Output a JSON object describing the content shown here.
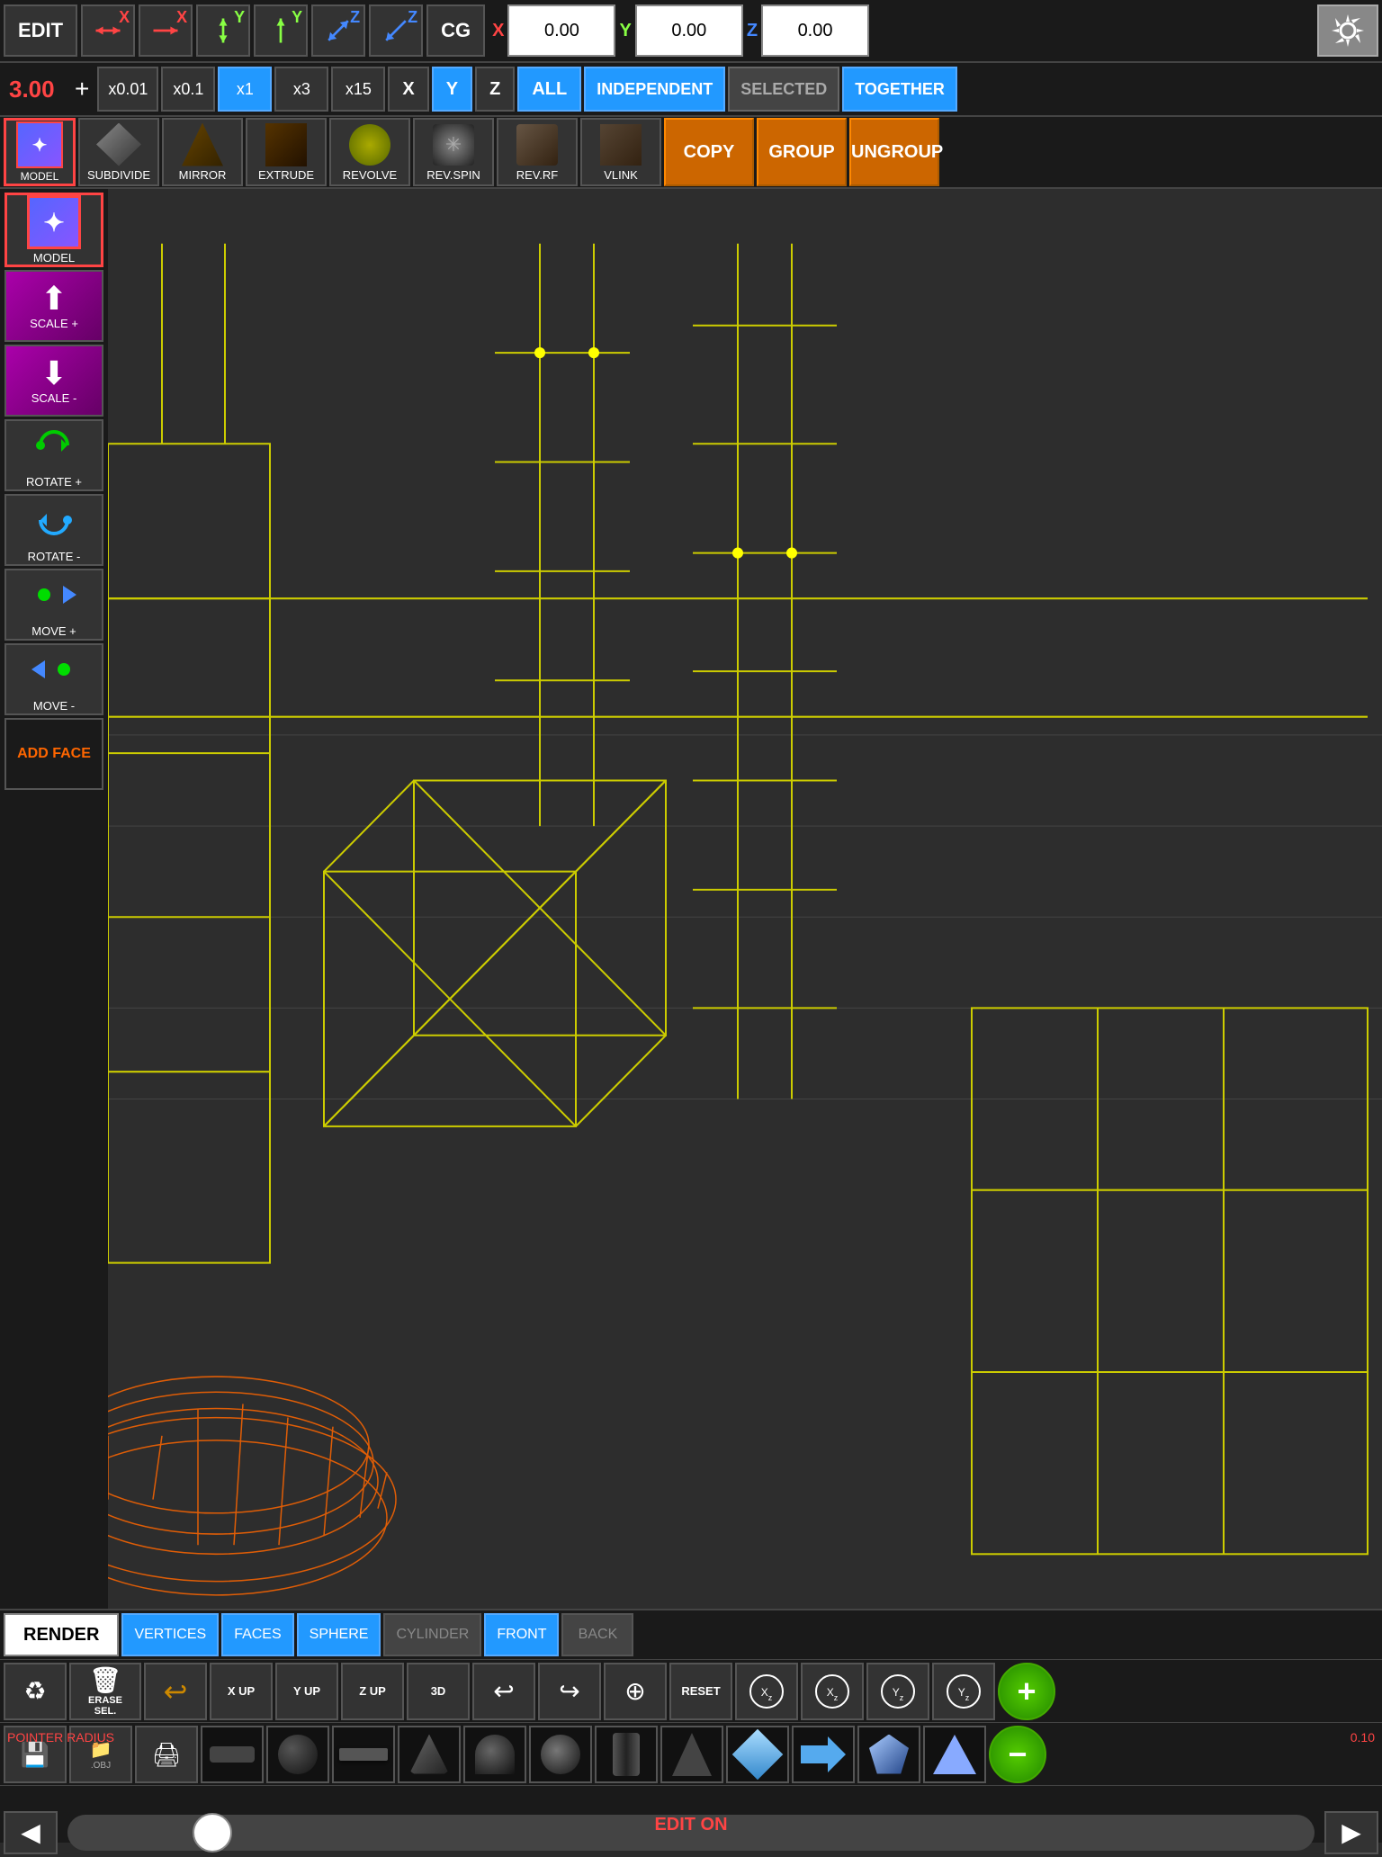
{
  "toolbar": {
    "edit_label": "EDIT",
    "cg_label": "CG",
    "settings_label": "⚙",
    "x_coord": "0.00",
    "y_coord": "0.00",
    "z_coord": "0.00"
  },
  "second_toolbar": {
    "value": "3.00",
    "plus_label": "+",
    "mult_options": [
      "x0.01",
      "x0.1",
      "x1",
      "x3",
      "x15"
    ],
    "active_mult": "x1",
    "axes": [
      "X",
      "Y",
      "Z",
      "ALL"
    ],
    "active_axis": "Y",
    "modes": [
      "INDEPENDENT",
      "SELECTED",
      "TOGETHER"
    ]
  },
  "operations": {
    "items": [
      {
        "label": "SUBDIVIDE",
        "icon": "subdivide"
      },
      {
        "label": "MIRROR",
        "icon": "mirror"
      },
      {
        "label": "EXTRUDE",
        "icon": "extrude"
      },
      {
        "label": "REVOLVE",
        "icon": "revolve"
      },
      {
        "label": "REV.SPIN",
        "icon": "revspin"
      },
      {
        "label": "REV.RF",
        "icon": "revrf"
      },
      {
        "label": "VLINK",
        "icon": "vlink"
      }
    ],
    "copy_label": "COPY",
    "group_label": "GROUP",
    "ungroup_label": "UNGROUP"
  },
  "left_sidebar": {
    "items": [
      {
        "label": "MODEL",
        "icon": "model",
        "active": true
      },
      {
        "label": "SCALE +",
        "icon": "scale_plus"
      },
      {
        "label": "SCALE -",
        "icon": "scale_minus"
      },
      {
        "label": "ROTATE +",
        "icon": "rotate_plus"
      },
      {
        "label": "ROTATE -",
        "icon": "rotate_minus"
      },
      {
        "label": "MOVE +",
        "icon": "move_plus"
      },
      {
        "label": "MOVE -",
        "icon": "move_minus"
      },
      {
        "label": "ADD FACE",
        "icon": "add_face"
      }
    ]
  },
  "bottom": {
    "render_label": "RENDER",
    "view_buttons": [
      "VERTICES",
      "FACES",
      "SPHERE",
      "CYLINDER",
      "FRONT",
      "BACK"
    ],
    "active_views": [
      "VERTICES",
      "FACES",
      "SPHERE",
      "FRONT"
    ],
    "action_row2": [
      {
        "label": "",
        "icon": "recycle"
      },
      {
        "label": "ERASE\nSEL.",
        "icon": "erase"
      },
      {
        "label": "",
        "icon": "undo_arrow"
      },
      {
        "label": "X UP",
        "icon": "x_up"
      },
      {
        "label": "Y UP",
        "icon": "y_up"
      },
      {
        "label": "Z UP",
        "icon": "z_up"
      },
      {
        "label": "3D",
        "icon": "3d"
      },
      {
        "label": "",
        "icon": "undo"
      },
      {
        "label": "",
        "icon": "redo"
      },
      {
        "label": "⊕",
        "icon": "move_cross"
      },
      {
        "label": "RESET",
        "icon": "reset"
      },
      {
        "label": "Xz",
        "icon": "rot_xz"
      },
      {
        "label": "Xz",
        "icon": "rot_xz2"
      },
      {
        "label": "Yz",
        "icon": "rot_yz"
      },
      {
        "label": "Yz",
        "icon": "rot_yz2"
      },
      {
        "label": "+",
        "icon": "plus_green"
      }
    ],
    "action_row3": [
      {
        "label": "",
        "icon": "save"
      },
      {
        "label": "",
        "icon": "save_obj"
      },
      {
        "label": "",
        "icon": "print"
      },
      {
        "label": "flat_dark",
        "icon": "flat_dark"
      },
      {
        "label": "circle_black",
        "icon": "circle_black"
      },
      {
        "label": "flat_lighter",
        "icon": "flat_lighter"
      },
      {
        "label": "cone_side",
        "icon": "cone_side"
      },
      {
        "label": "half_sphere",
        "icon": "half_sphere"
      },
      {
        "label": "circle2",
        "icon": "circle2"
      },
      {
        "label": "cylinder_dark",
        "icon": "cylinder_dark"
      },
      {
        "label": "cone_dark",
        "icon": "cone_dark"
      },
      {
        "label": "diamond_blue",
        "icon": "diamond_blue"
      },
      {
        "label": "arrow_right_blue",
        "icon": "arrow_right_blue"
      },
      {
        "label": "gem_blue",
        "icon": "gem_blue"
      },
      {
        "label": "triangle_up_blue",
        "icon": "triangle_up_blue"
      },
      {
        "label": "-",
        "icon": "minus_green"
      }
    ],
    "pointer_radius_label": "POINTER RADIUS",
    "pointer_radius_value": "0.10",
    "nav": {
      "left_label": "◀",
      "right_label": "▶"
    },
    "edit_on_label": "EDIT ON"
  }
}
